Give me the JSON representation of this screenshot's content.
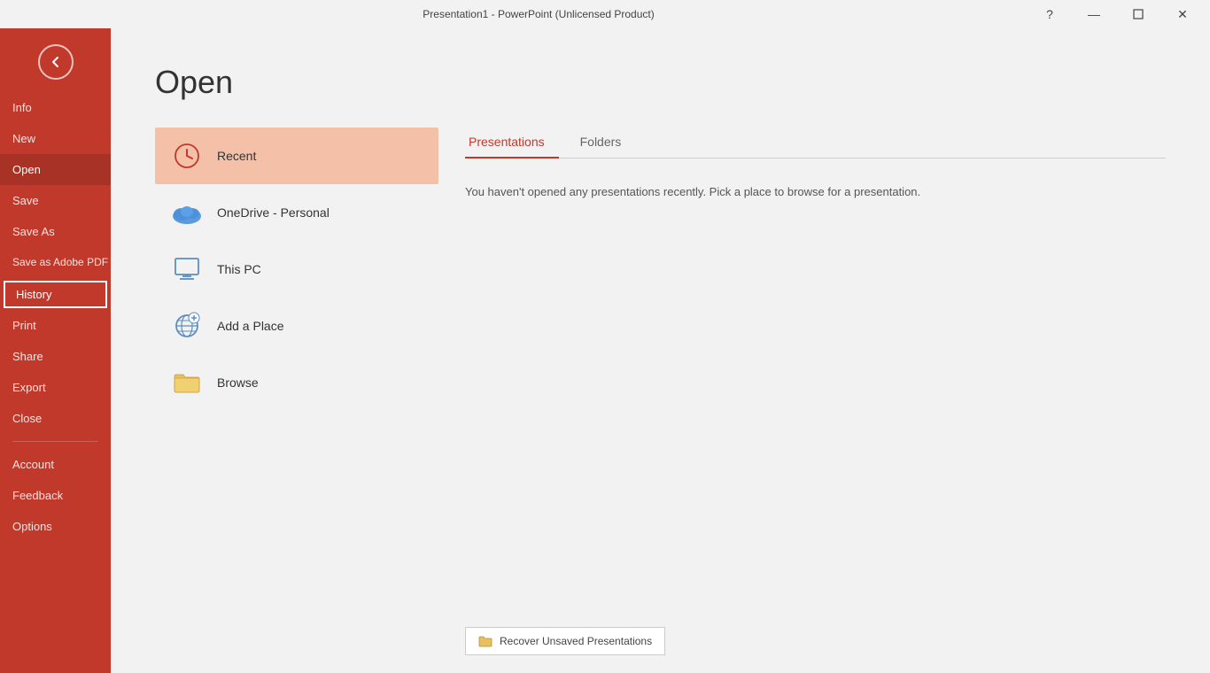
{
  "titlebar": {
    "title": "Presentation1 - PowerPoint (Unlicensed Product)",
    "help": "?",
    "minimize": "—",
    "restore": "❐",
    "close": "✕"
  },
  "sidebar": {
    "back_label": "←",
    "items": [
      {
        "id": "info",
        "label": "Info",
        "active": false
      },
      {
        "id": "new",
        "label": "New",
        "active": false
      },
      {
        "id": "open",
        "label": "Open",
        "active": true
      },
      {
        "id": "save",
        "label": "Save",
        "active": false
      },
      {
        "id": "save-as",
        "label": "Save As",
        "active": false
      },
      {
        "id": "save-as-adobe",
        "label": "Save as Adobe PDF",
        "active": false
      },
      {
        "id": "history",
        "label": "History",
        "highlighted": true,
        "active": false
      },
      {
        "id": "print",
        "label": "Print",
        "active": false
      },
      {
        "id": "share",
        "label": "Share",
        "active": false
      },
      {
        "id": "export",
        "label": "Export",
        "active": false
      },
      {
        "id": "close",
        "label": "Close",
        "active": false
      }
    ],
    "bottom_items": [
      {
        "id": "account",
        "label": "Account"
      },
      {
        "id": "feedback",
        "label": "Feedback"
      },
      {
        "id": "options",
        "label": "Options"
      }
    ]
  },
  "main": {
    "page_title": "Open",
    "locations": [
      {
        "id": "recent",
        "label": "Recent",
        "icon": "clock-icon",
        "active": true
      },
      {
        "id": "onedrive",
        "label": "OneDrive - Personal",
        "icon": "cloud-icon",
        "active": false
      },
      {
        "id": "this-pc",
        "label": "This PC",
        "icon": "computer-icon",
        "active": false
      },
      {
        "id": "add-place",
        "label": "Add a Place",
        "icon": "globe-icon",
        "active": false
      },
      {
        "id": "browse",
        "label": "Browse",
        "icon": "folder-icon",
        "active": false
      }
    ],
    "tabs": [
      {
        "id": "presentations",
        "label": "Presentations",
        "active": true
      },
      {
        "id": "folders",
        "label": "Folders",
        "active": false
      }
    ],
    "empty_message": "You haven't opened any presentations recently. Pick a place to browse for a presentation.",
    "recover_button": "Recover Unsaved Presentations"
  }
}
